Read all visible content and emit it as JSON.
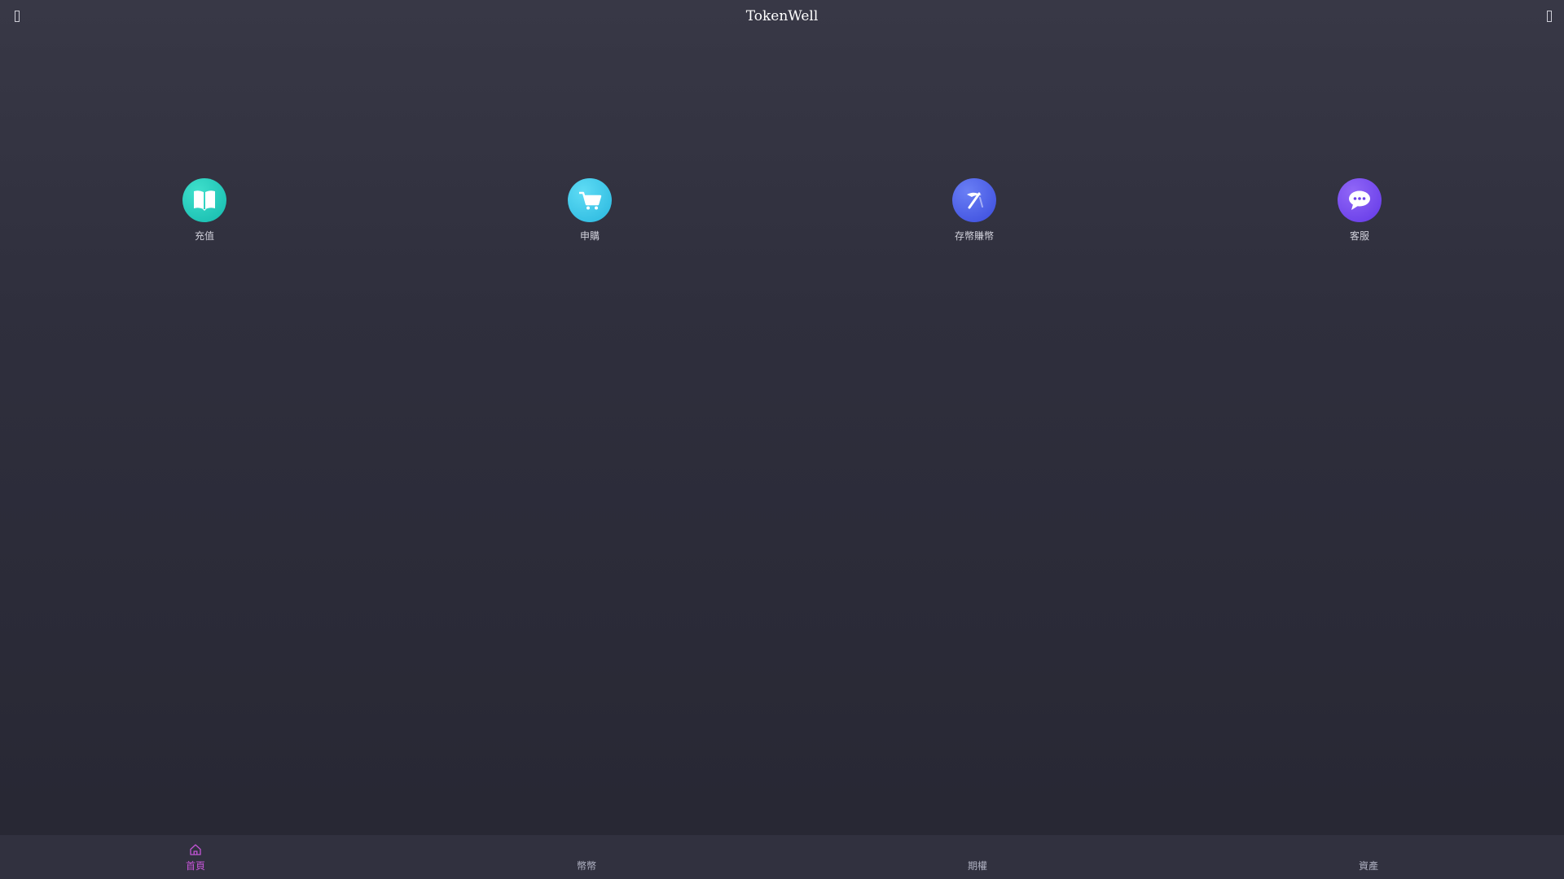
{
  "header": {
    "title": "TokenWell",
    "left_icon": "back-icon",
    "right_icon": "menu-icon"
  },
  "shortcuts": [
    {
      "label": "充值",
      "icon": "book-icon",
      "color": "#1fc7b6"
    },
    {
      "label": "申購",
      "icon": "cart-icon",
      "color": "#36c5e6"
    },
    {
      "label": "存幣賺幣",
      "icon": "pickaxe-icon",
      "color": "#4a5fe8"
    },
    {
      "label": "客服",
      "icon": "chat-icon",
      "color": "#7a4ff0"
    }
  ],
  "tabbar": {
    "active_color": "#c355d6",
    "tabs": [
      {
        "label": "首頁",
        "icon": "home-icon",
        "active": true
      },
      {
        "label": "幣幣",
        "active": false
      },
      {
        "label": "期權",
        "active": false
      },
      {
        "label": "資產",
        "active": false
      }
    ]
  }
}
